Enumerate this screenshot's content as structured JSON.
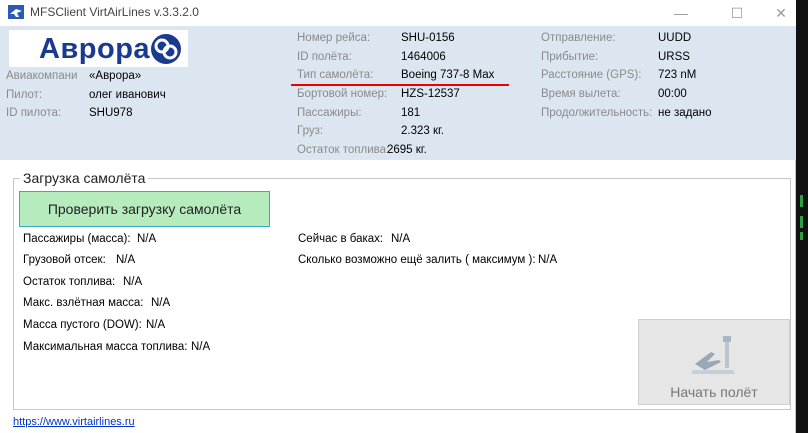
{
  "window": {
    "title": "MFSClient VirtAirLines v.3.3.2.0",
    "minimize_glyph": "—",
    "maximize_glyph": "☐",
    "close_glyph": "✕"
  },
  "header": {
    "logo_text": "Аврора",
    "airline_label": "Авиакомпани",
    "airline_value": "«Аврора»",
    "pilot_label": "Пилот:",
    "pilot_value": "олег иванович",
    "pilot_id_label": "ID пилота:",
    "pilot_id_value": "SHU978",
    "flight_number_label": "Номер рейса:",
    "flight_number_value": "SHU-0156",
    "flight_id_label": "ID полёта:",
    "flight_id_value": "1464006",
    "aircraft_type_label": "Тип самолёта:",
    "aircraft_type_value": "Boeing 737-8 Max",
    "tail_number_label": "Бортовой номер:",
    "tail_number_value": "HZS-12537",
    "passengers_label": "Пассажиры:",
    "passengers_value": "181",
    "cargo_label": "Груз:",
    "cargo_value": "2.323 кг.",
    "fuel_left_label": "Остаток топлива:",
    "fuel_left_value": "2695 кг.",
    "departure_label": "Отправление:",
    "departure_value": "UUDD",
    "arrival_label": "Прибытие:",
    "arrival_value": "URSS",
    "distance_label": "Расстояние (GPS):",
    "distance_value": "723 nM",
    "dep_time_label": "Время вылета:",
    "dep_time_value": "00:00",
    "duration_label": "Продолжительность:",
    "duration_value": "не задано"
  },
  "loading": {
    "group_title": "Загрузка самолёта",
    "check_button": "Проверить загрузку самолёта",
    "rows_left": [
      {
        "label": "Пассажиры (масса):",
        "value": "N/A"
      },
      {
        "label": "Грузовой отсек:",
        "value": "N/A"
      },
      {
        "label": "Остаток топлива:",
        "value": "N/A"
      },
      {
        "label": "Макс. взлётная масса:",
        "value": "N/A"
      },
      {
        "label": "Масса пустого (DOW):",
        "value": "N/A"
      },
      {
        "label": "Максимальная масса топлива:",
        "value": "N/A"
      }
    ],
    "rows_right": [
      {
        "label": "Сейчас в баках:",
        "value": "N/A"
      },
      {
        "label": "Сколько возможно ещё залить ( максимум ):",
        "value": "N/A"
      }
    ],
    "start_button": "Начать полёт",
    "start_icon": "airplane-tower-icon"
  },
  "footer": {
    "link_text": "https://www.virtairlines.ru"
  },
  "colors": {
    "header_bg": "#dce6f1",
    "logo_blue": "#1a3a8f",
    "check_button_bg": "#b6ebbd",
    "check_button_border": "#3aa6c8",
    "highlight_underline": "#e00000",
    "link": "#0033cc"
  }
}
